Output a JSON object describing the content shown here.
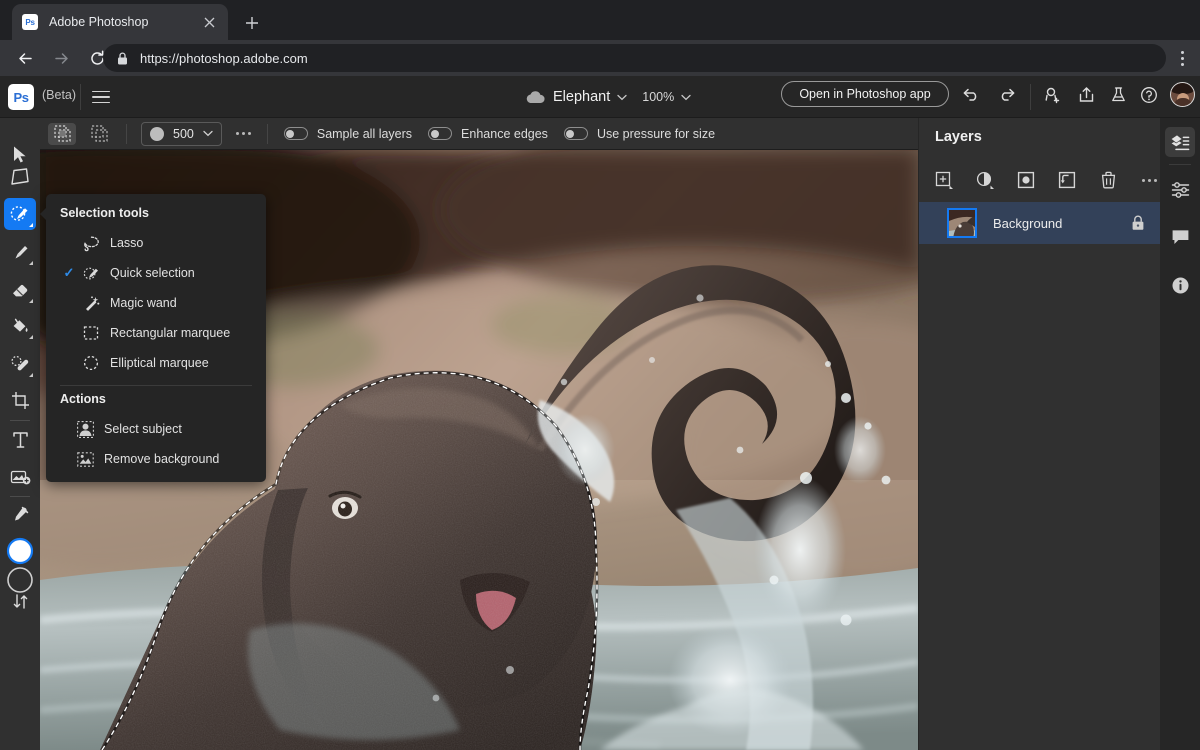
{
  "browser": {
    "tab": {
      "title": "Adobe Photoshop",
      "favicon": "photoshop-favicon",
      "close_icon": "✕"
    },
    "new_tab_icon": "+",
    "back_icon": "←",
    "forward_icon": "→",
    "reload_icon": "⟳",
    "lock_icon": "lock-icon",
    "url": "https://photoshop.adobe.com",
    "menu_icon": "kebab-menu-icon"
  },
  "appbar": {
    "logo_text": "Ps",
    "beta_label": "(Beta)",
    "menu_icon": "hamburger-icon",
    "cloud_icon": "cloud-icon",
    "document_name": "Elephant",
    "document_chevron": "⌄",
    "zoom_level": "100%",
    "zoom_chevron": "⌄",
    "open_in_app_label": "Open in Photoshop app",
    "undo_icon": "undo-icon",
    "redo_icon": "redo-icon",
    "invite_icon": "add-collaborator-icon",
    "share_icon": "share-icon",
    "beta_flask_icon": "flask-icon",
    "help_icon": "help-icon",
    "avatar": "user-avatar"
  },
  "options_bar": {
    "add_to_selection_icon": "add-to-selection-icon",
    "subtract_from_selection_icon": "subtract-from-selection-icon",
    "brush_size": "500",
    "brush_chevron": "⌄",
    "more_options_icon": "more-options-icon",
    "toggles": [
      {
        "label": "Sample all layers",
        "on": false
      },
      {
        "label": "Enhance edges",
        "on": false
      },
      {
        "label": "Use pressure for size",
        "on": false
      }
    ]
  },
  "toolbar": {
    "items": [
      {
        "name": "move-tool",
        "icon": "cursor-arrow-icon",
        "active": false,
        "has_corner": false
      },
      {
        "name": "transform-tool",
        "icon": "transform-icon",
        "active": false,
        "has_corner": false
      },
      {
        "name": "quick-selection-tool",
        "icon": "quick-selection-icon",
        "active": true,
        "has_corner": true
      },
      {
        "name": "brush-tool",
        "icon": "brush-icon",
        "active": false,
        "has_corner": true
      },
      {
        "name": "eraser-tool",
        "icon": "eraser-icon",
        "active": false,
        "has_corner": true
      },
      {
        "name": "paint-bucket-tool",
        "icon": "paint-bucket-icon",
        "active": false,
        "has_corner": true
      },
      {
        "name": "healing-brush-tool",
        "icon": "healing-brush-icon",
        "active": false,
        "has_corner": true
      },
      {
        "name": "crop-tool",
        "icon": "crop-icon",
        "active": false,
        "has_corner": false
      },
      {
        "name": "type-tool",
        "icon": "text-icon",
        "active": false,
        "has_corner": false
      },
      {
        "name": "generative-fill-tool",
        "icon": "generative-image-icon",
        "active": false,
        "has_corner": false
      },
      {
        "name": "eyedropper-tool",
        "icon": "eyedropper-icon",
        "active": false,
        "has_corner": false
      }
    ],
    "foreground_color": "#ffffff",
    "background_color": "#ffffff",
    "swap_colors_icon": "swap-arrows-icon"
  },
  "flyout": {
    "heading": "Selection tools",
    "checkmark": "✓",
    "tools": [
      {
        "label": "Lasso",
        "icon": "lasso-icon",
        "selected": false
      },
      {
        "label": "Quick selection",
        "icon": "quick-selection-icon",
        "selected": true
      },
      {
        "label": "Magic wand",
        "icon": "magic-wand-icon",
        "selected": false
      },
      {
        "label": "Rectangular marquee",
        "icon": "rectangular-marquee-icon",
        "selected": false
      },
      {
        "label": "Elliptical marquee",
        "icon": "elliptical-marquee-icon",
        "selected": false
      }
    ],
    "actions_heading": "Actions",
    "actions": [
      {
        "label": "Select subject",
        "icon": "select-subject-icon"
      },
      {
        "label": "Remove background",
        "icon": "remove-background-icon"
      }
    ]
  },
  "layers_panel": {
    "title": "Layers",
    "tools": [
      {
        "name": "add-layer-button",
        "icon": "add-layer-icon"
      },
      {
        "name": "adjustment-layer-button",
        "icon": "adjustment-layer-icon"
      },
      {
        "name": "add-mask-button",
        "icon": "layer-mask-icon"
      },
      {
        "name": "clipping-mask-button",
        "icon": "clipping-mask-icon"
      },
      {
        "name": "delete-layer-button",
        "icon": "trash-icon"
      },
      {
        "name": "layer-more-button",
        "icon": "more-options-icon"
      }
    ],
    "layers": [
      {
        "name": "Background",
        "locked": true,
        "selected": true,
        "lock_icon": "lock-icon"
      }
    ]
  },
  "right_rail": {
    "items": [
      {
        "name": "rail-layers",
        "icon": "layers-icon",
        "active": true
      },
      {
        "name": "rail-adjustments",
        "icon": "sliders-icon",
        "active": false
      },
      {
        "name": "rail-comments",
        "icon": "comment-icon",
        "active": false
      },
      {
        "name": "rail-info",
        "icon": "info-icon",
        "active": false
      }
    ]
  },
  "canvas": {
    "image_description": "elephant-splashing-water-photo",
    "selection_active": true,
    "background_color": "#363636"
  },
  "colors": {
    "accent": "#147af3",
    "panel_bg": "#303030",
    "app_bg": "#262626",
    "menu_bg": "#252525",
    "selected_row": "#33415c"
  }
}
